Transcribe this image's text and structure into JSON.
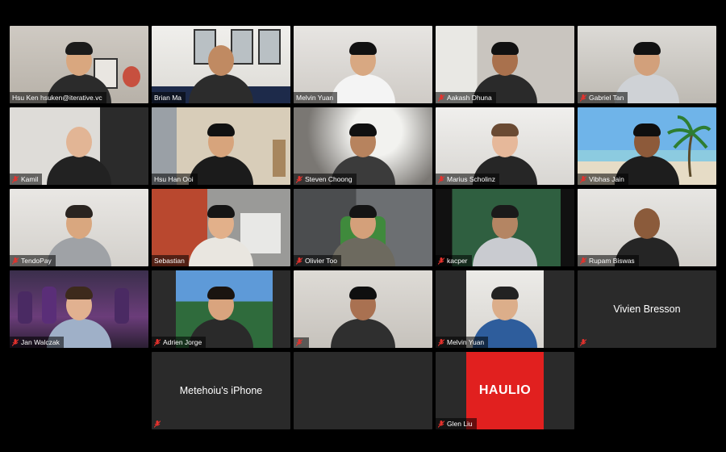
{
  "participants": [
    {
      "name": "Hsu Ken hsuken@iterative.vc",
      "muted": false
    },
    {
      "name": "Brian Ma",
      "muted": false
    },
    {
      "name": "Melvin Yuan",
      "muted": false
    },
    {
      "name": "Aakash Dhuna",
      "muted": true
    },
    {
      "name": "Gabriel Tan",
      "muted": true
    },
    {
      "name": "Kamil",
      "muted": true
    },
    {
      "name": "Hsu Han Ooi",
      "muted": false,
      "active_speaker": true
    },
    {
      "name": "Steven Choong",
      "muted": true
    },
    {
      "name": "Marius Scholinz",
      "muted": true
    },
    {
      "name": "Vibhas Jain",
      "muted": true
    },
    {
      "name": "TendoPay",
      "muted": true
    },
    {
      "name": "Sebastian",
      "muted": false
    },
    {
      "name": "Olivier Too",
      "muted": true
    },
    {
      "name": "kacper",
      "muted": true
    },
    {
      "name": "Rupam Biswas",
      "muted": true
    },
    {
      "name": "Jan Walczak",
      "muted": true
    },
    {
      "name": "Adrien Jorge",
      "muted": true
    },
    {
      "name": "",
      "muted": true
    },
    {
      "name": "Melvin Yuan",
      "muted": true
    },
    {
      "name": "Vivien Bresson",
      "muted": true,
      "video_off": true
    },
    {
      "name": "Metehoiu's iPhone",
      "muted": true,
      "video_off": true
    },
    {
      "name": "",
      "muted": false,
      "video_off": true
    },
    {
      "name": "Glen Liu",
      "muted": true,
      "logo_text": "HAULIO"
    }
  ],
  "colors": {
    "background": "#000000",
    "tile": "#2a2a2a",
    "active_border": "#c8d96a",
    "mute_icon": "#e5322d",
    "logo_red": "#e1201f"
  },
  "icons": {
    "mute": "mic-muted-icon"
  }
}
